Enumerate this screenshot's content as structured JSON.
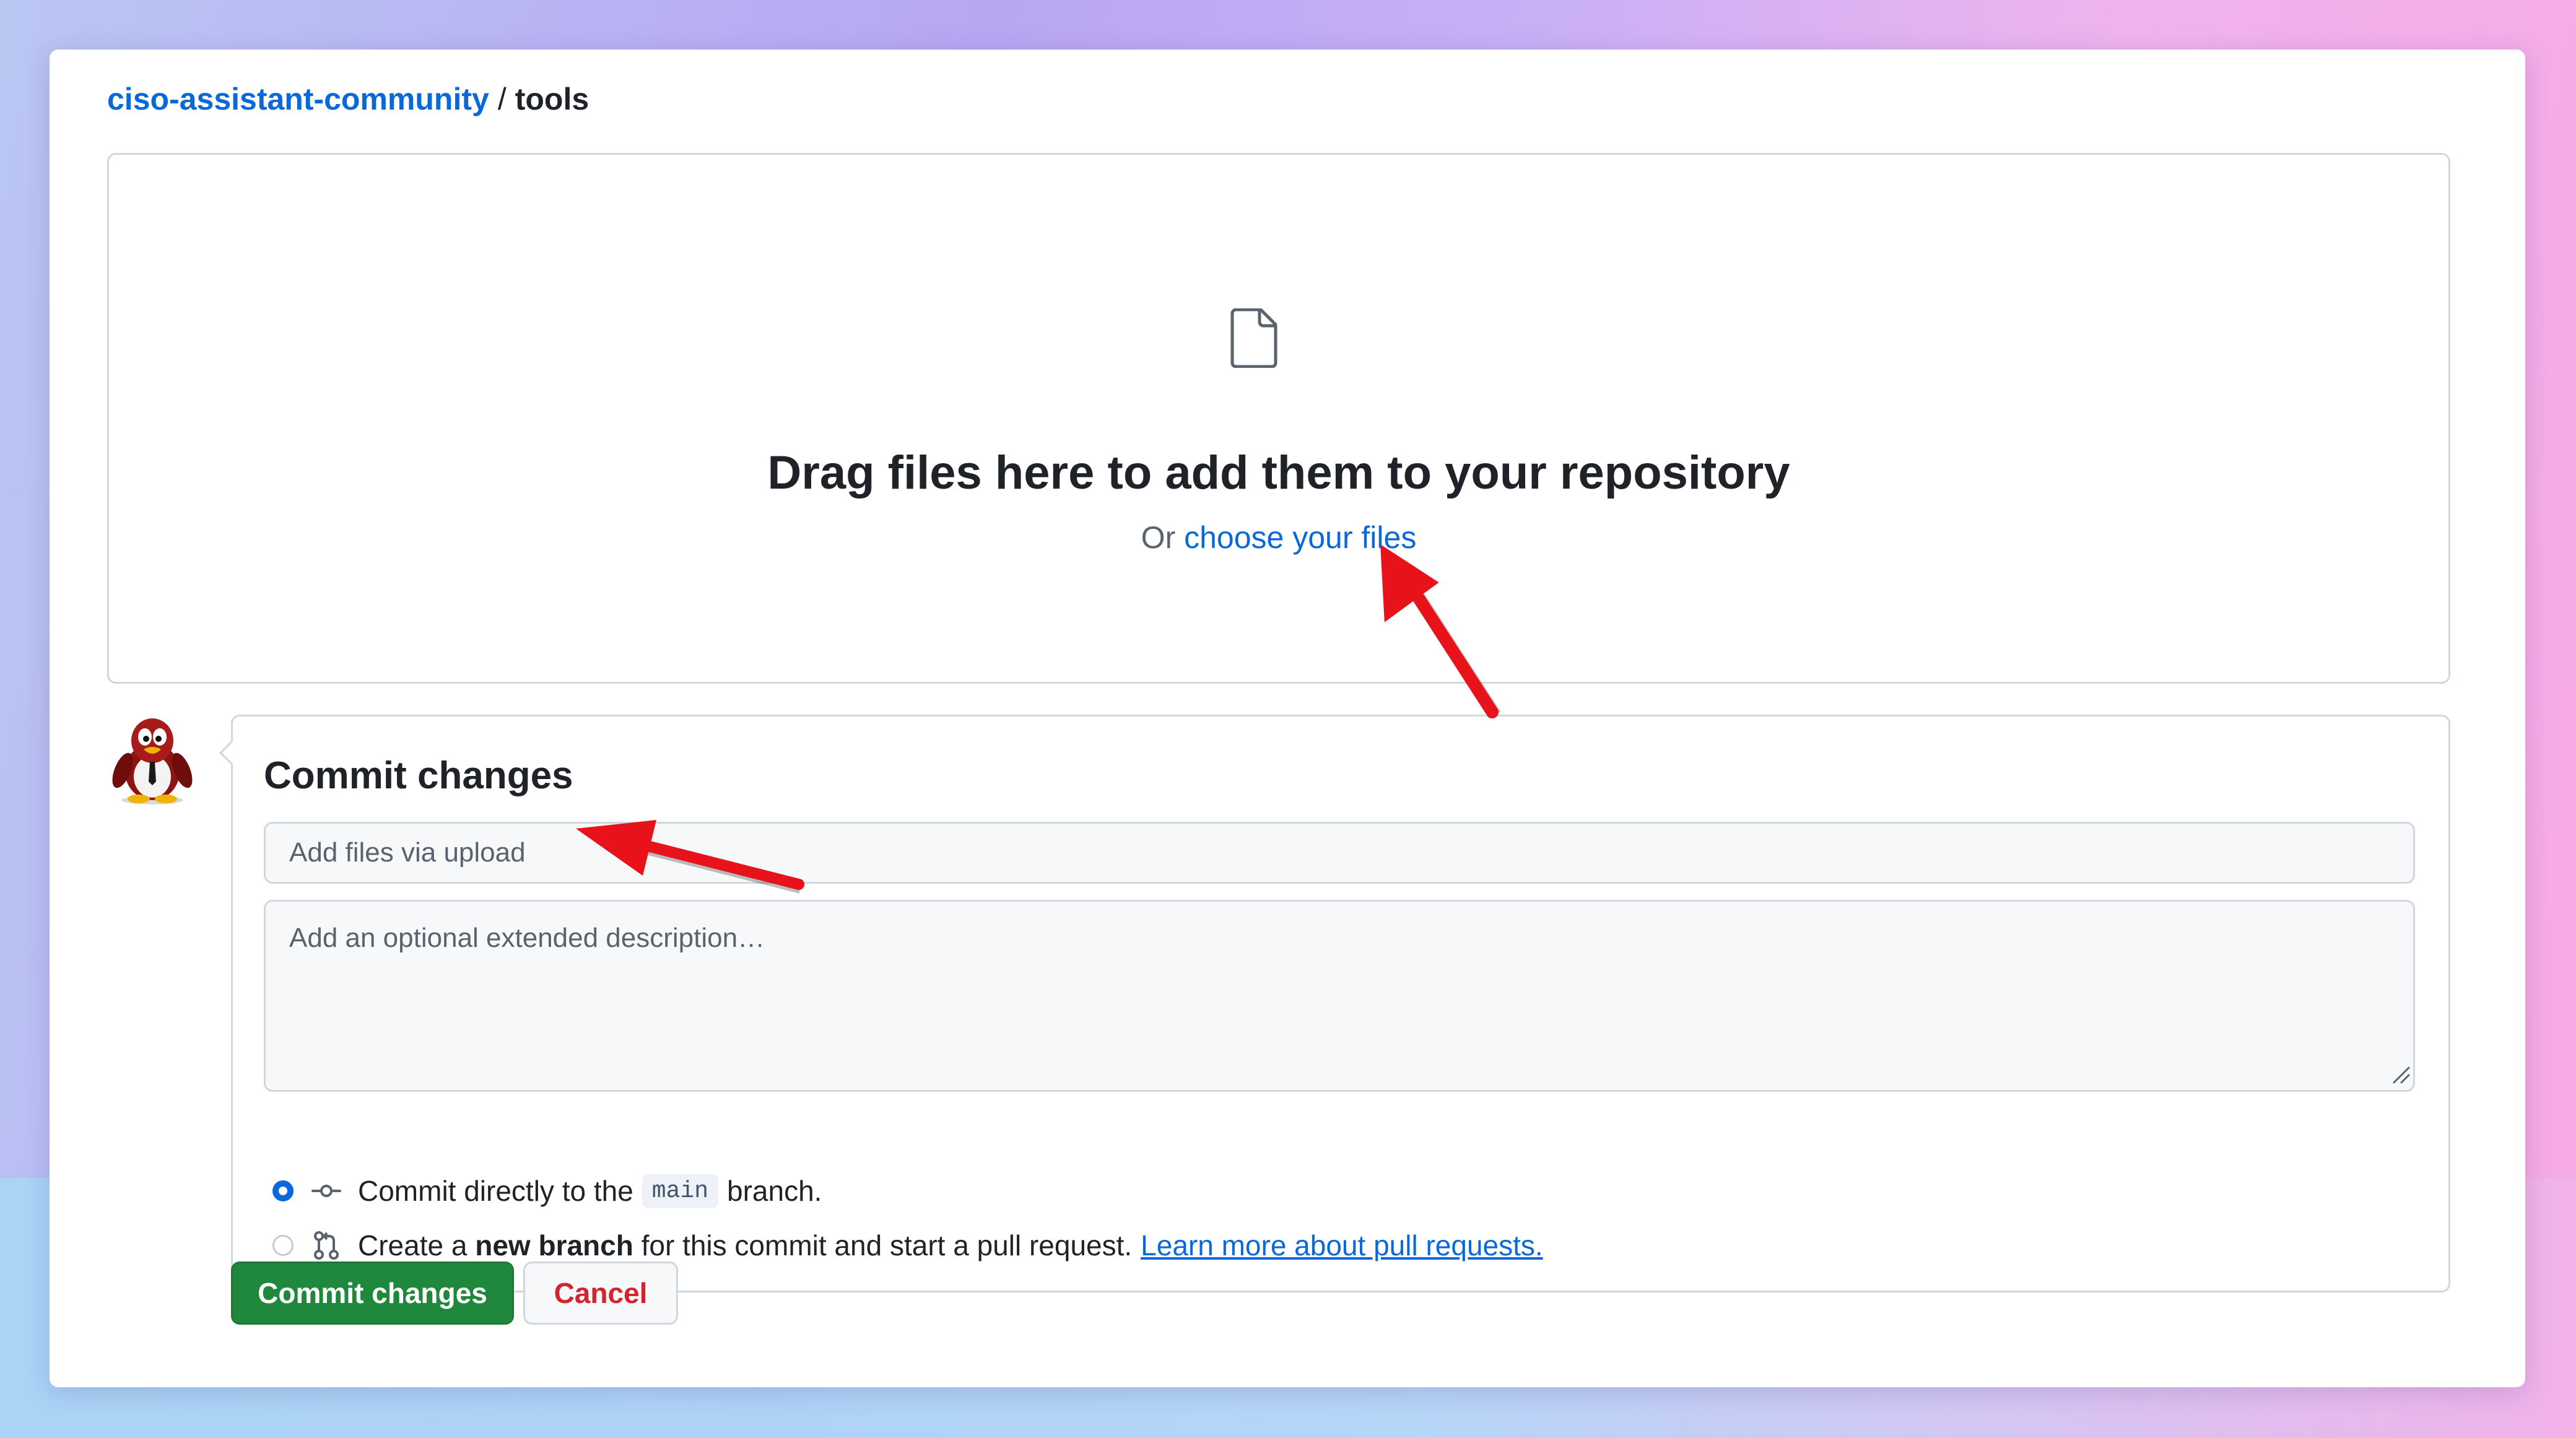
{
  "breadcrumb": {
    "owner": "ciso-assistant-community",
    "separator": "/",
    "repo": "tools"
  },
  "dropzone": {
    "icon": "file-icon",
    "title": "Drag files here to add them to your repository",
    "prefix": "Or",
    "choose_link": "choose your files"
  },
  "avatar": {
    "icon": "penguin-avatar"
  },
  "commit": {
    "heading": "Commit changes",
    "summary_placeholder": "Add files via upload",
    "summary_value": "",
    "description_placeholder": "Add an optional extended description…",
    "description_value": "",
    "options": {
      "direct": {
        "selected": true,
        "icon": "git-commit-icon",
        "text_before": "Commit directly to the",
        "branch": "main",
        "text_after": "branch."
      },
      "new_branch": {
        "selected": false,
        "icon": "git-pull-request-icon",
        "text_before": "Create a",
        "bold": "new branch",
        "text_after": "for this commit and start a pull request.",
        "link": "Learn more about pull requests."
      }
    }
  },
  "buttons": {
    "commit_label": "Commit changes",
    "cancel_label": "Cancel"
  },
  "colors": {
    "link": "#0969da",
    "primary_button": "#1f883d",
    "danger_text": "#d1242f",
    "annotation_arrow": "#e8121b"
  }
}
